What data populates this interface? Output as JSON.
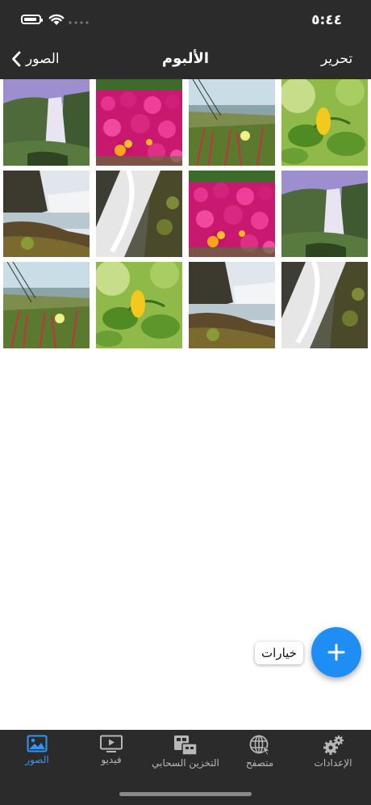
{
  "status_bar": {
    "time": "٥:٤٤"
  },
  "nav": {
    "edit_label": "تحرير",
    "title": "الألبوم",
    "back_label": "الصور"
  },
  "photos": [
    {
      "subject": "waterfall"
    },
    {
      "subject": "pink-flowers"
    },
    {
      "subject": "coastal-plants"
    },
    {
      "subject": "yellow-leaf"
    },
    {
      "subject": "coastal-waterfall"
    },
    {
      "subject": "rushing-water"
    },
    {
      "subject": "pink-flowers"
    },
    {
      "subject": "waterfall"
    },
    {
      "subject": "coastal-plants"
    },
    {
      "subject": "yellow-leaf"
    },
    {
      "subject": "coastal-waterfall"
    },
    {
      "subject": "rushing-water"
    }
  ],
  "options": {
    "label": "خيارات"
  },
  "fab": {
    "icon": "plus-icon",
    "color": "#1e8ef5"
  },
  "tabs": [
    {
      "label": "الصور",
      "icon": "photos-icon",
      "active": true
    },
    {
      "label": "فيديو",
      "icon": "video-icon",
      "active": false
    },
    {
      "label": "التخزين السحابي",
      "icon": "cloud-storage-icon",
      "active": false
    },
    {
      "label": "متصفح",
      "icon": "globe-icon",
      "active": false
    },
    {
      "label": "الإعدادات",
      "icon": "gear-icon",
      "active": false
    }
  ],
  "colors": {
    "bar_background": "#2b2b2b",
    "accent": "#2f97f3",
    "inactive_tab": "#b7b7b7"
  }
}
